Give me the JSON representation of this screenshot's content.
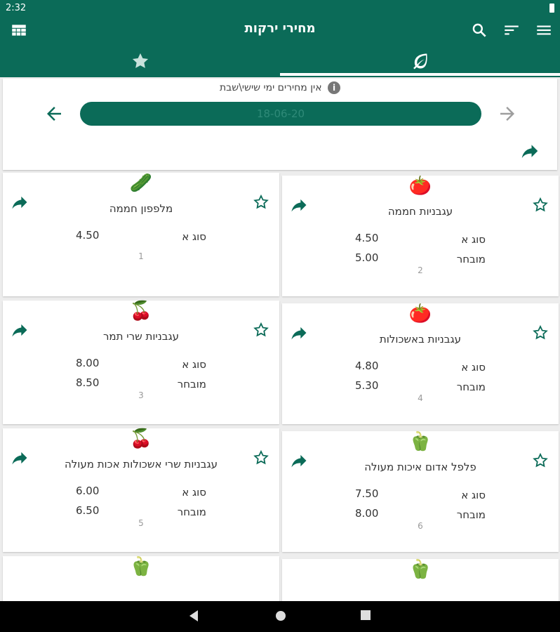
{
  "status": {
    "time": "2:32"
  },
  "appbar": {
    "title": "מחירי ירקות",
    "icons": [
      "grid-icon",
      "search-icon",
      "sort-icon",
      "menu-icon"
    ]
  },
  "tabs": [
    {
      "icon": "star-icon"
    },
    {
      "icon": "leaf-icon",
      "selected": true
    }
  ],
  "date_section": {
    "notice": "אין מחירים ימי שישי\\שבת",
    "date": "18-06-20"
  },
  "colors": {
    "primary": "#0b6b58",
    "card": "#ffffff",
    "background": "#ededed"
  },
  "products": [
    {
      "index": "1",
      "emoji": "🥒",
      "name": "מלפפון חממה",
      "prices": [
        {
          "label": "סוג א",
          "value": "4.50"
        }
      ]
    },
    {
      "index": "2",
      "emoji": "🍅",
      "name": "עגבניות חממה",
      "prices": [
        {
          "label": "סוג א",
          "value": "4.50"
        },
        {
          "label": "מובחר",
          "value": "5.00"
        }
      ]
    },
    {
      "index": "3",
      "emoji": "🍒",
      "name": "עגבניות שרי תמר",
      "prices": [
        {
          "label": "סוג א",
          "value": "8.00"
        },
        {
          "label": "מובחר",
          "value": "8.50"
        }
      ]
    },
    {
      "index": "4",
      "emoji": "🍅",
      "name": "עגבניות באשכולות",
      "prices": [
        {
          "label": "סוג א",
          "value": "4.80"
        },
        {
          "label": "מובחר",
          "value": "5.30"
        }
      ]
    },
    {
      "index": "5",
      "emoji": "🍒",
      "name": "עגבניות שרי אשכולות אכות מעולה",
      "prices": [
        {
          "label": "סוג א",
          "value": "6.00"
        },
        {
          "label": "מובחר",
          "value": "6.50"
        }
      ]
    },
    {
      "index": "6",
      "emoji": "🫑",
      "name": "פלפל אדום איכות מעולה",
      "prices": [
        {
          "label": "סוג א",
          "value": "7.50"
        },
        {
          "label": "מובחר",
          "value": "8.00"
        }
      ]
    },
    {
      "index": "",
      "emoji": "🫑",
      "name": "",
      "prices": []
    },
    {
      "index": "",
      "emoji": "🫑",
      "name": "",
      "prices": []
    }
  ]
}
